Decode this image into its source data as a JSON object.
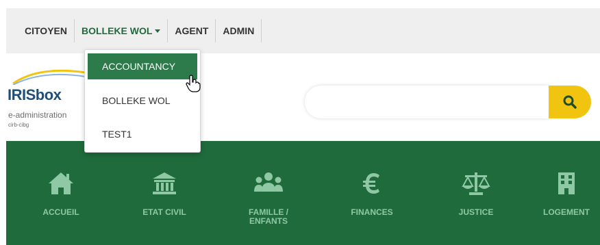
{
  "topnav": {
    "items": [
      {
        "label": "CITOYEN"
      },
      {
        "label": "BOLLEKE WOL"
      },
      {
        "label": "AGENT"
      },
      {
        "label": "ADMIN"
      }
    ]
  },
  "dropdown": {
    "items": [
      {
        "label": "ACCOUNTANCY"
      },
      {
        "label": "BOLLEKE WOL"
      },
      {
        "label": "TEST1"
      }
    ]
  },
  "logo": {
    "brand": "IRISbox",
    "tagline": "e-administration",
    "small": "cirb-cibg"
  },
  "search": {
    "placeholder": ""
  },
  "mainnav": {
    "items": [
      {
        "label": "ACCUEIL",
        "icon": "home-icon"
      },
      {
        "label": "ETAT CIVIL",
        "icon": "building-icon"
      },
      {
        "label": "FAMILLE / ENFANTS",
        "icon": "family-icon"
      },
      {
        "label": "FINANCES",
        "icon": "euro-icon"
      },
      {
        "label": "JUSTICE",
        "icon": "scales-icon"
      },
      {
        "label": "LOGEMENT",
        "icon": "apartment-icon"
      }
    ]
  },
  "colors": {
    "green": "#1f6b3c",
    "icon_green": "#8fc8a4",
    "search_yellow": "#f1c40f",
    "topbar_gray": "#efefef"
  }
}
